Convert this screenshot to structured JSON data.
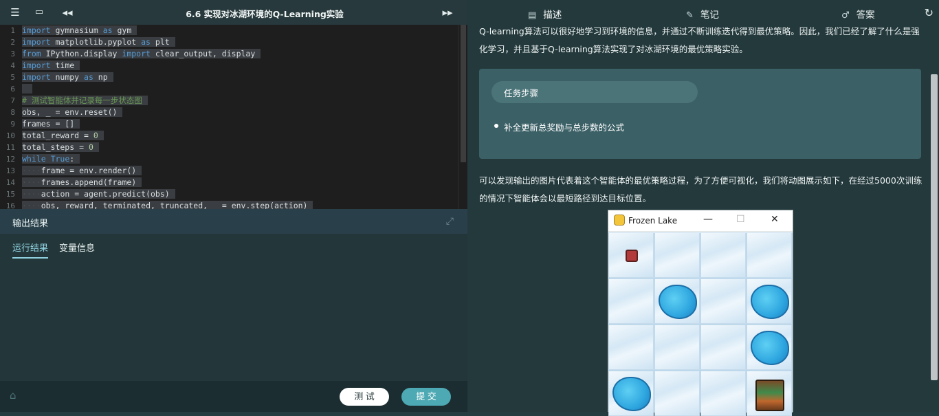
{
  "header": {
    "title": "6.6 实现对冰湖环境的Q-Learning实验",
    "icons": [
      "outline-icon",
      "fullscreen-icon",
      "collapse-left-icon",
      "expand-right-icon"
    ]
  },
  "editor": {
    "line_numbers": [
      "1",
      "2",
      "3",
      "4",
      "5",
      "6",
      "7",
      "8",
      "9",
      "10",
      "11",
      "12",
      "13",
      "14",
      "15",
      "16"
    ],
    "lines": [
      "import gymnasium as gym",
      "import matplotlib.pyplot as plt",
      "from IPython.display import clear_output, display",
      "import time",
      "import numpy as np",
      "",
      "# 测试智能体并记录每一步状态图",
      "obs, _ = env.reset()",
      "frames = []",
      "total_reward = 0",
      "total_steps = 0",
      "while True:",
      "    frame = env.render()",
      "    frames.append(frame)",
      "    action = agent.predict(obs)",
      "    obs, reward, terminated, truncated, _ = env.step(action)"
    ]
  },
  "output": {
    "title": "输出结果",
    "tabs": [
      "运行结果",
      "变量信息"
    ]
  },
  "actions": {
    "test_label": "测 试",
    "submit_label": "提 交"
  },
  "right_tabs": {
    "describe": "描述",
    "notes": "笔记",
    "answer": "答案"
  },
  "content": {
    "intro": "Q-learning算法可以很好地学习到环境的信息，并通过不断训练迭代得到最优策略。因此，我们已经了解了什么是强化学习，并且基于Q-learning算法实现了对冰湖环境的最优策略实验。",
    "task_title": "任务步骤",
    "task_item": "补全更新总奖励与总步数的公式",
    "result_text": "可以发现输出的图片代表着这个智能体的最优策略过程，为了方便可视化，我们将动图展示如下，在经过5000次训练的情况下智能体会以最短路径到达目标位置。"
  },
  "game_window": {
    "title": "Frozen Lake",
    "grid": [
      [
        "agent",
        "ice",
        "ice",
        "ice"
      ],
      [
        "ice",
        "hole",
        "ice",
        "hole"
      ],
      [
        "ice",
        "ice",
        "ice",
        "hole"
      ],
      [
        "hole",
        "ice",
        "ice",
        "goal"
      ]
    ]
  },
  "colors": {
    "accent": "#4da9b3",
    "panel": "#243c3f",
    "editor_bg": "#1e1e1e"
  }
}
